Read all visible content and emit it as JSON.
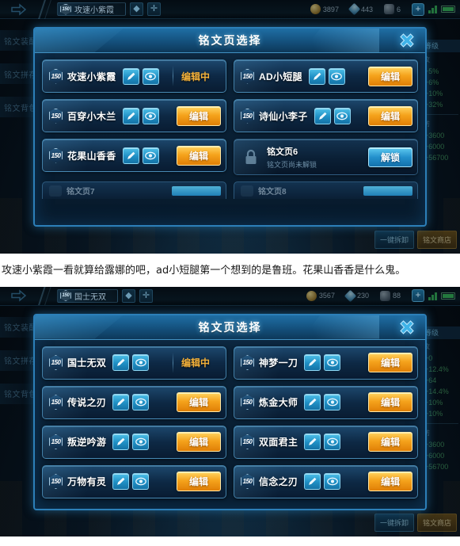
{
  "shots": [
    {
      "topbar": {
        "back_icon": "back-arrow-icon",
        "level_badge": "150",
        "player_name": "攻速小紫霞",
        "icon1": "bag-icon",
        "icon2": "plus-icon",
        "gold": "3897",
        "gem": "443",
        "ticket": "6",
        "plus_label": "+"
      },
      "background": {
        "tabs": [
          "铭文装配",
          "铭文拼存",
          "铭文背包"
        ],
        "stats_header": "等级",
        "stats_group1_label": "攻",
        "stats_group1": [
          "+5%",
          "+6%",
          "+10%",
          "+32%"
        ],
        "stats_group2_label": "防",
        "stats_group2": [
          "+3600",
          "+6000",
          "+56700"
        ],
        "btn_dismantle": "一键拆卸",
        "btn_shop": "铭文商店"
      },
      "dialog": {
        "title": "铭文页选择",
        "close_icon": "close-icon",
        "cards": [
          {
            "badge": "150",
            "name": "攻速小紫霞",
            "icons": [
              "tag-icon",
              "eye-icon"
            ],
            "action_type": "status",
            "action_label": "编辑中",
            "locked": false
          },
          {
            "badge": "150",
            "name": "AD小短腿",
            "icons": [
              "tag-icon",
              "eye-icon"
            ],
            "action_type": "gold",
            "action_label": "编辑",
            "locked": false
          },
          {
            "badge": "150",
            "name": "百穿小木兰",
            "icons": [
              "tag-icon",
              "eye-icon"
            ],
            "action_type": "gold",
            "action_label": "编辑",
            "locked": false
          },
          {
            "badge": "150",
            "name": "诗仙小李子",
            "icons": [
              "tag-icon",
              "eye-icon"
            ],
            "action_type": "gold",
            "action_label": "编辑",
            "locked": false
          },
          {
            "badge": "150",
            "name": "花果山香香",
            "icons": [
              "tag-icon",
              "eye-icon"
            ],
            "action_type": "gold",
            "action_label": "编辑",
            "locked": false
          },
          {
            "locked": true,
            "lock_icon": "lock-icon",
            "name": "铭文页6",
            "sub": "铭文页尚未解锁",
            "action_type": "blue",
            "action_label": "解锁"
          }
        ],
        "partial_cards": [
          {
            "name": "铭文页7",
            "lock_icon": "lock-icon"
          },
          {
            "name": "铭文页8",
            "lock_icon": "lock-icon"
          }
        ]
      }
    },
    {
      "topbar": {
        "back_icon": "back-arrow-icon",
        "level_badge": "150",
        "player_name": "国士无双",
        "icon1": "bag-icon",
        "icon2": "plus-icon",
        "gold": "3567",
        "gem": "230",
        "ticket": "88",
        "plus_label": "+"
      },
      "background": {
        "tabs": [
          "铭文装配",
          "铭文拼存",
          "铭文背包"
        ],
        "stats_header": "等级",
        "stats_group1_label": "攻",
        "stats_group1": [
          "+0",
          "+12.4%",
          "+64",
          "+14.4%",
          "+10%",
          "+10%"
        ],
        "stats_group2_label": "防",
        "stats_group2": [
          "+3600",
          "+6000",
          "+56700"
        ],
        "btn_dismantle": "一键拆卸",
        "btn_shop": "铭文商店"
      },
      "dialog": {
        "title": "铭文页选择",
        "close_icon": "close-icon",
        "cards": [
          {
            "badge": "150",
            "name": "国士无双",
            "icons": [
              "tag-icon",
              "eye-icon"
            ],
            "action_type": "status",
            "action_label": "编辑中",
            "locked": false
          },
          {
            "badge": "150",
            "name": "神梦一刀",
            "icons": [
              "tag-icon",
              "eye-icon"
            ],
            "action_type": "gold",
            "action_label": "编辑",
            "locked": false
          },
          {
            "badge": "150",
            "name": "传说之刃",
            "icons": [
              "tag-icon",
              "eye-icon"
            ],
            "action_type": "gold",
            "action_label": "编辑",
            "locked": false
          },
          {
            "badge": "150",
            "name": "炼金大师",
            "icons": [
              "tag-icon",
              "eye-icon"
            ],
            "action_type": "gold",
            "action_label": "编辑",
            "locked": false
          },
          {
            "badge": "150",
            "name": "叛逆吟游",
            "icons": [
              "tag-icon",
              "eye-icon"
            ],
            "action_type": "gold",
            "action_label": "编辑",
            "locked": false
          },
          {
            "badge": "150",
            "name": "双面君主",
            "icons": [
              "tag-icon",
              "eye-icon"
            ],
            "action_type": "gold",
            "action_label": "编辑",
            "locked": false
          },
          {
            "badge": "150",
            "name": "万物有灵",
            "icons": [
              "tag-icon",
              "eye-icon"
            ],
            "action_type": "gold",
            "action_label": "编辑",
            "locked": false
          },
          {
            "badge": "150",
            "name": "信念之刃",
            "icons": [
              "tag-icon",
              "eye-icon"
            ],
            "action_type": "gold",
            "action_label": "编辑",
            "locked": false
          }
        ],
        "partial_cards": []
      }
    }
  ],
  "caption": "攻速小紫霞一看就算给露娜的吧，ad小短腿第一个想到的是鲁班。花果山香香是什么鬼。",
  "colors": {
    "accent_blue": "#2c7fb8",
    "accent_gold": "#f5a31c",
    "status_orange": "#f3b13a",
    "stat_green": "#3f8f56"
  }
}
